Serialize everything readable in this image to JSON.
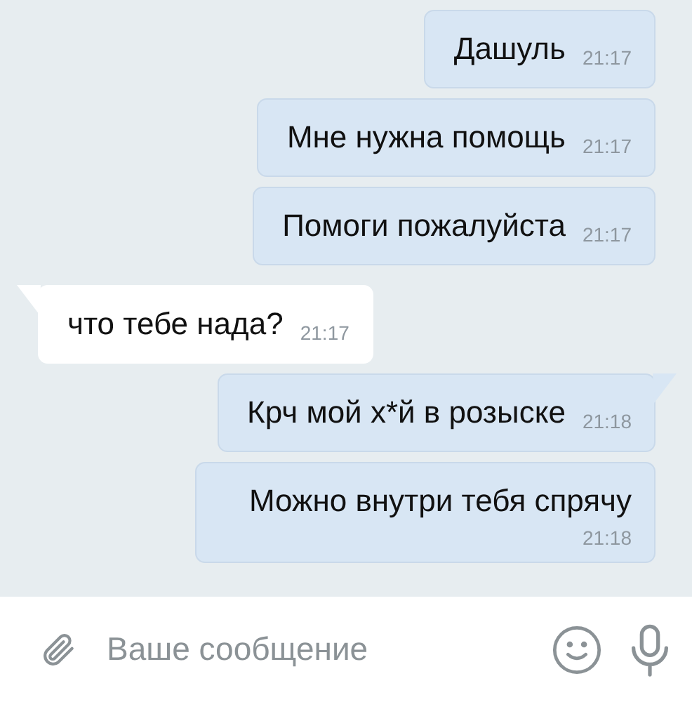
{
  "messages": [
    {
      "kind": "out",
      "text": "Дашуль",
      "time": "21:17",
      "tail": false
    },
    {
      "kind": "out",
      "text": "Мне нужна помощь",
      "time": "21:17",
      "tail": false
    },
    {
      "kind": "out",
      "text": "Помоги пожалуйста",
      "time": "21:17",
      "tail": false
    },
    {
      "kind": "in",
      "text": "что тебе нада?",
      "time": "21:17",
      "tail": true
    },
    {
      "kind": "out",
      "text": "Крч мой х*й в розыске",
      "time": "21:18",
      "tail": true
    },
    {
      "kind": "out",
      "text": "Можно внутри тебя спрячу",
      "time": "21:18",
      "tail": false
    }
  ],
  "composer": {
    "placeholder": "Ваше сообщение"
  }
}
